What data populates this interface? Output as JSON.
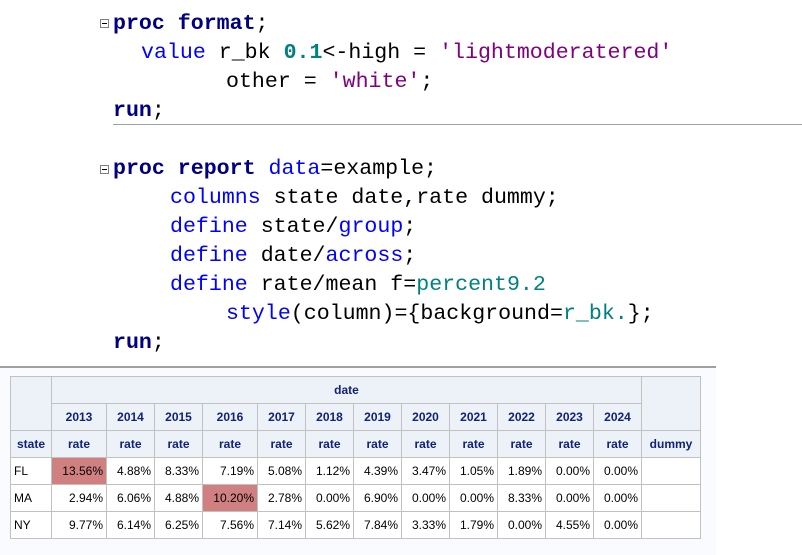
{
  "code": {
    "lines": [
      [
        [
          "proc format",
          "kw"
        ],
        [
          ";",
          ""
        ]
      ],
      [
        [
          "value",
          "blue"
        ],
        [
          " r_bk ",
          ""
        ],
        [
          "0.1",
          "teal"
        ],
        [
          "<-high = ",
          ""
        ],
        [
          "'lightmoderatered'",
          "str"
        ]
      ],
      [
        [
          "other = ",
          ""
        ],
        [
          "'white'",
          "str"
        ],
        [
          ";",
          ""
        ]
      ],
      [
        [
          "run",
          "kw"
        ],
        [
          ";",
          ""
        ]
      ],
      [
        [
          "proc report ",
          "kw"
        ],
        [
          "data",
          "blue"
        ],
        [
          "=example;",
          ""
        ]
      ],
      [
        [
          "columns",
          "blue"
        ],
        [
          " state date,rate dummy;",
          ""
        ]
      ],
      [
        [
          "define",
          "blue"
        ],
        [
          " state/",
          ""
        ],
        [
          "group",
          "blue"
        ],
        [
          ";",
          ""
        ]
      ],
      [
        [
          "define",
          "blue"
        ],
        [
          " date/",
          ""
        ],
        [
          "across",
          "blue"
        ],
        [
          ";",
          ""
        ]
      ],
      [
        [
          "define",
          "blue"
        ],
        [
          " rate/mean f=",
          ""
        ],
        [
          "percent9.2",
          "tealn"
        ]
      ],
      [
        [
          "style",
          "blue"
        ],
        [
          "(column)={background=",
          ""
        ],
        [
          "r_bk.",
          "tealn"
        ],
        [
          "};",
          ""
        ]
      ],
      [
        [
          "run",
          "kw"
        ],
        [
          ";",
          ""
        ]
      ]
    ]
  },
  "report": {
    "across_label": "date",
    "group_header": "state",
    "stat_label": "rate",
    "dummy_header": "dummy",
    "years": [
      "2013",
      "2014",
      "2015",
      "2016",
      "2017",
      "2018",
      "2019",
      "2020",
      "2021",
      "2022",
      "2023",
      "2024"
    ],
    "highlight_color": "#d08080",
    "rows": [
      {
        "state": "FL",
        "values": [
          "13.56%",
          "4.88%",
          "8.33%",
          "7.19%",
          "5.08%",
          "1.12%",
          "4.39%",
          "3.47%",
          "1.05%",
          "1.89%",
          "0.00%",
          "0.00%"
        ],
        "highlight": [
          0
        ]
      },
      {
        "state": "MA",
        "values": [
          "2.94%",
          "6.06%",
          "4.88%",
          "10.20%",
          "2.78%",
          "0.00%",
          "6.90%",
          "0.00%",
          "0.00%",
          "8.33%",
          "0.00%",
          "0.00%"
        ],
        "highlight": [
          3
        ]
      },
      {
        "state": "NY",
        "values": [
          "9.77%",
          "6.14%",
          "6.25%",
          "7.56%",
          "7.14%",
          "5.62%",
          "7.84%",
          "3.33%",
          "1.79%",
          "0.00%",
          "4.55%",
          "0.00%"
        ],
        "highlight": []
      }
    ]
  }
}
